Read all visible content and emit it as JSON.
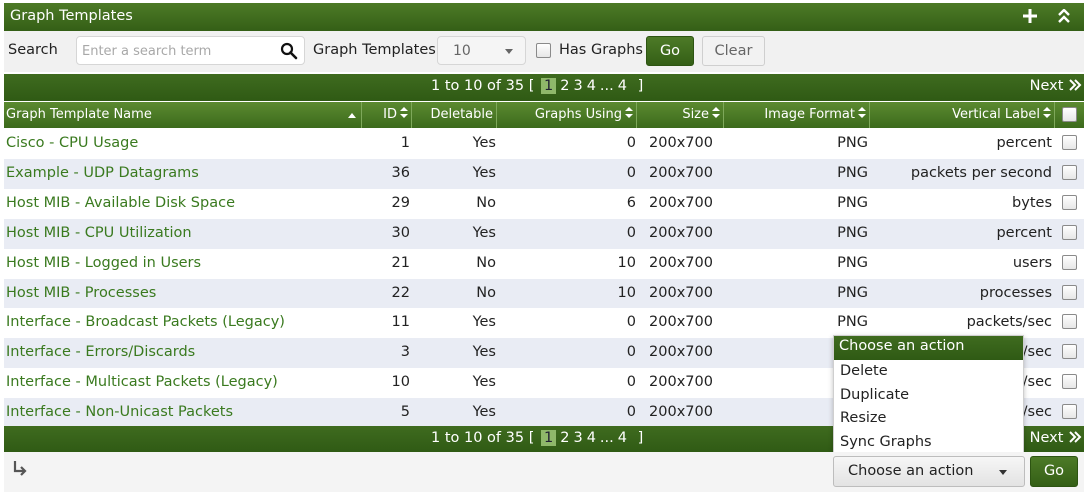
{
  "title": "Graph Templates",
  "title_icons": [
    "plus-icon",
    "collapse-icon"
  ],
  "filter": {
    "search_label": "Search",
    "search_placeholder": "Enter a search term",
    "search_value": "",
    "rows_label": "Graph Templates",
    "rows_value": "10",
    "has_graphs_label": "Has Graphs",
    "has_graphs_checked": false,
    "go_label": "Go",
    "clear_label": "Clear"
  },
  "nav": {
    "range_text": "1 to 10 of 35 [",
    "pages": [
      "1",
      "2",
      "3",
      "4"
    ],
    "current_page": "1",
    "ellipsis": "...",
    "last_page": "4",
    "close_bracket": "]",
    "next_label": "Next",
    "next_icon": "double-chevron-right-icon"
  },
  "columns": [
    {
      "label": "Graph Template Name",
      "sort": "asc"
    },
    {
      "label": "ID",
      "sort": "both"
    },
    {
      "label": "Deletable",
      "sort": "none"
    },
    {
      "label": "Graphs Using",
      "sort": "both"
    },
    {
      "label": "Size",
      "sort": "both"
    },
    {
      "label": "Image Format",
      "sort": "both"
    },
    {
      "label": "Vertical Label",
      "sort": "both"
    }
  ],
  "rows": [
    {
      "name": "Cisco - CPU Usage",
      "id": "1",
      "deletable": "Yes",
      "graphs": "0",
      "size": "200x700",
      "format": "PNG",
      "vlabel": "percent"
    },
    {
      "name": "Example - UDP Datagrams",
      "id": "36",
      "deletable": "Yes",
      "graphs": "0",
      "size": "200x700",
      "format": "PNG",
      "vlabel": "packets per second"
    },
    {
      "name": "Host MIB - Available Disk Space",
      "id": "29",
      "deletable": "No",
      "graphs": "6",
      "size": "200x700",
      "format": "PNG",
      "vlabel": "bytes"
    },
    {
      "name": "Host MIB - CPU Utilization",
      "id": "30",
      "deletable": "Yes",
      "graphs": "0",
      "size": "200x700",
      "format": "PNG",
      "vlabel": "percent"
    },
    {
      "name": "Host MIB - Logged in Users",
      "id": "21",
      "deletable": "No",
      "graphs": "10",
      "size": "200x700",
      "format": "PNG",
      "vlabel": "users"
    },
    {
      "name": "Host MIB - Processes",
      "id": "22",
      "deletable": "No",
      "graphs": "10",
      "size": "200x700",
      "format": "PNG",
      "vlabel": "processes"
    },
    {
      "name": "Interface - Broadcast Packets (Legacy)",
      "id": "11",
      "deletable": "Yes",
      "graphs": "0",
      "size": "200x700",
      "format": "PNG",
      "vlabel": "packets/sec"
    },
    {
      "name": "Interface - Errors/Discards",
      "id": "3",
      "deletable": "Yes",
      "graphs": "0",
      "size": "200x700",
      "format": "",
      "vlabel": "/sec"
    },
    {
      "name": "Interface - Multicast Packets (Legacy)",
      "id": "10",
      "deletable": "Yes",
      "graphs": "0",
      "size": "200x700",
      "format": "",
      "vlabel": "/sec"
    },
    {
      "name": "Interface - Non-Unicast Packets",
      "id": "5",
      "deletable": "Yes",
      "graphs": "0",
      "size": "200x700",
      "format": "",
      "vlabel": "/sec"
    }
  ],
  "action_menu": {
    "header": "Choose an action",
    "items": [
      "Delete",
      "Duplicate",
      "Resize",
      "Sync Graphs"
    ]
  },
  "footer": {
    "action_value": "Choose an action",
    "go_label": "Go",
    "return_icon": "return-arrow-icon"
  },
  "colors": {
    "brand_green": "#3f6b1f",
    "link_green": "#3a7a1f",
    "row_alt": "#e9ecf4"
  }
}
